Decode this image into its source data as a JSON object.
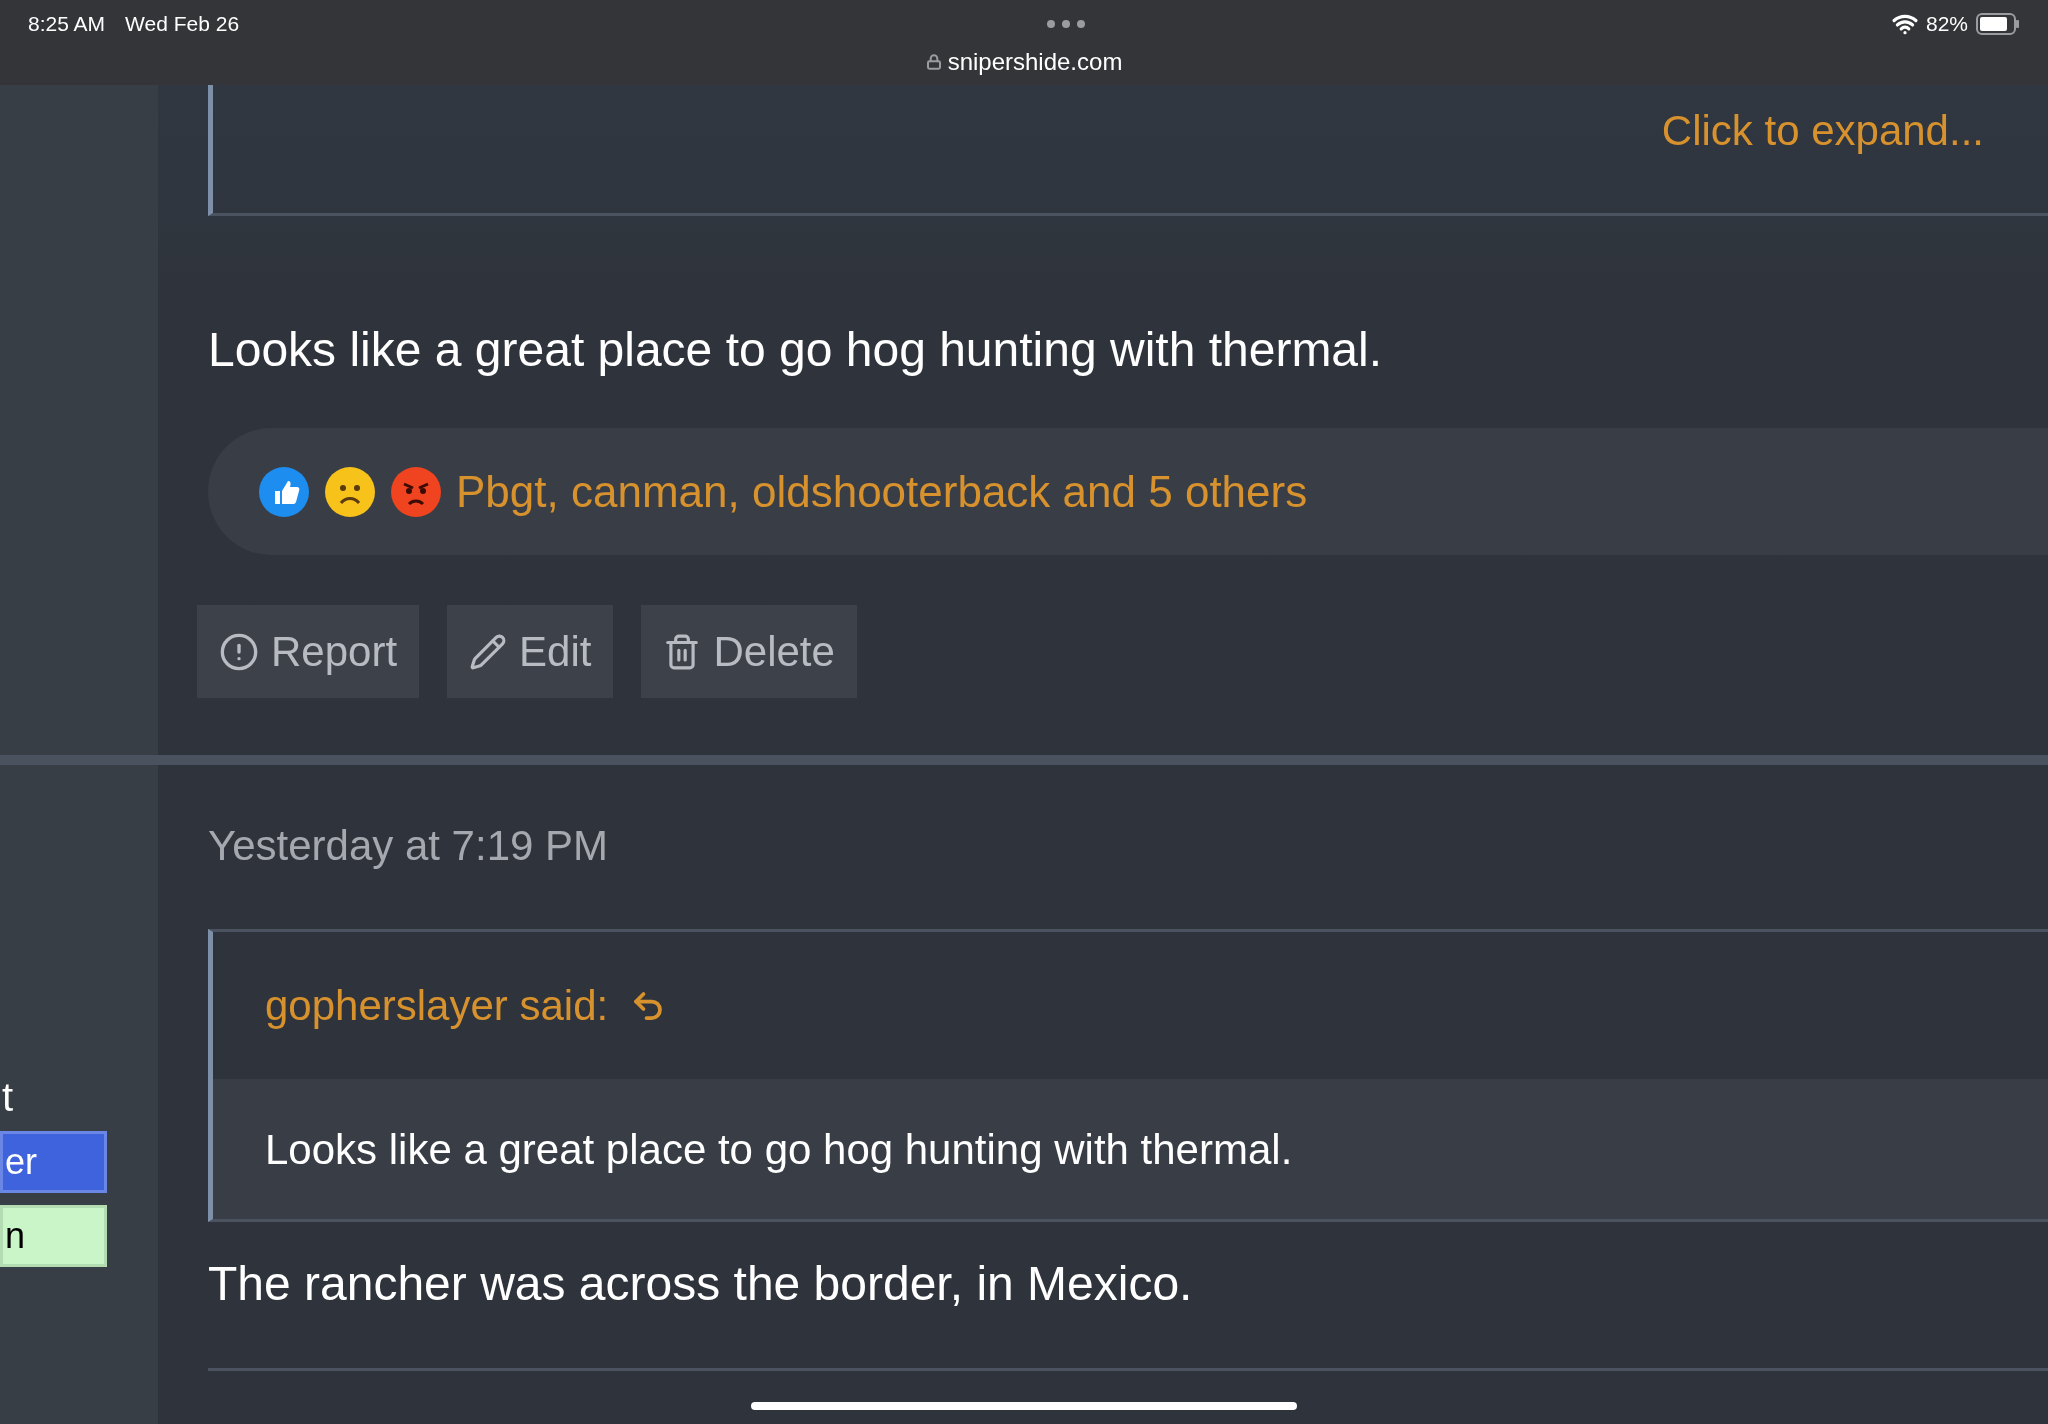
{
  "status_bar": {
    "time": "8:25 AM",
    "date": "Wed Feb 26",
    "url": "snipershide.com",
    "battery": "82%"
  },
  "sidebar": {
    "fragments": [
      {
        "kind": "text",
        "text": "t"
      },
      {
        "kind": "primary",
        "text": "er"
      },
      {
        "kind": "success",
        "text": "n"
      }
    ]
  },
  "post_1": {
    "quote_link": "Click to expand...",
    "body": "Looks like a great place to go hog hunting with thermal.",
    "reactions": "Pbgt, canman, oldshooterback and 5 others",
    "actions": [
      {
        "kind": "report",
        "label": "Report"
      },
      {
        "kind": "edit",
        "label": "Edit"
      },
      {
        "kind": "delete",
        "label": "Delete"
      }
    ]
  },
  "post_2": {
    "timestamp": "Yesterday at 7:19 PM",
    "quote": {
      "author": "gopherslayer said:",
      "text": "Looks like a great place to go hog hunting with thermal."
    },
    "body": "The rancher was across the border, in Mexico."
  }
}
